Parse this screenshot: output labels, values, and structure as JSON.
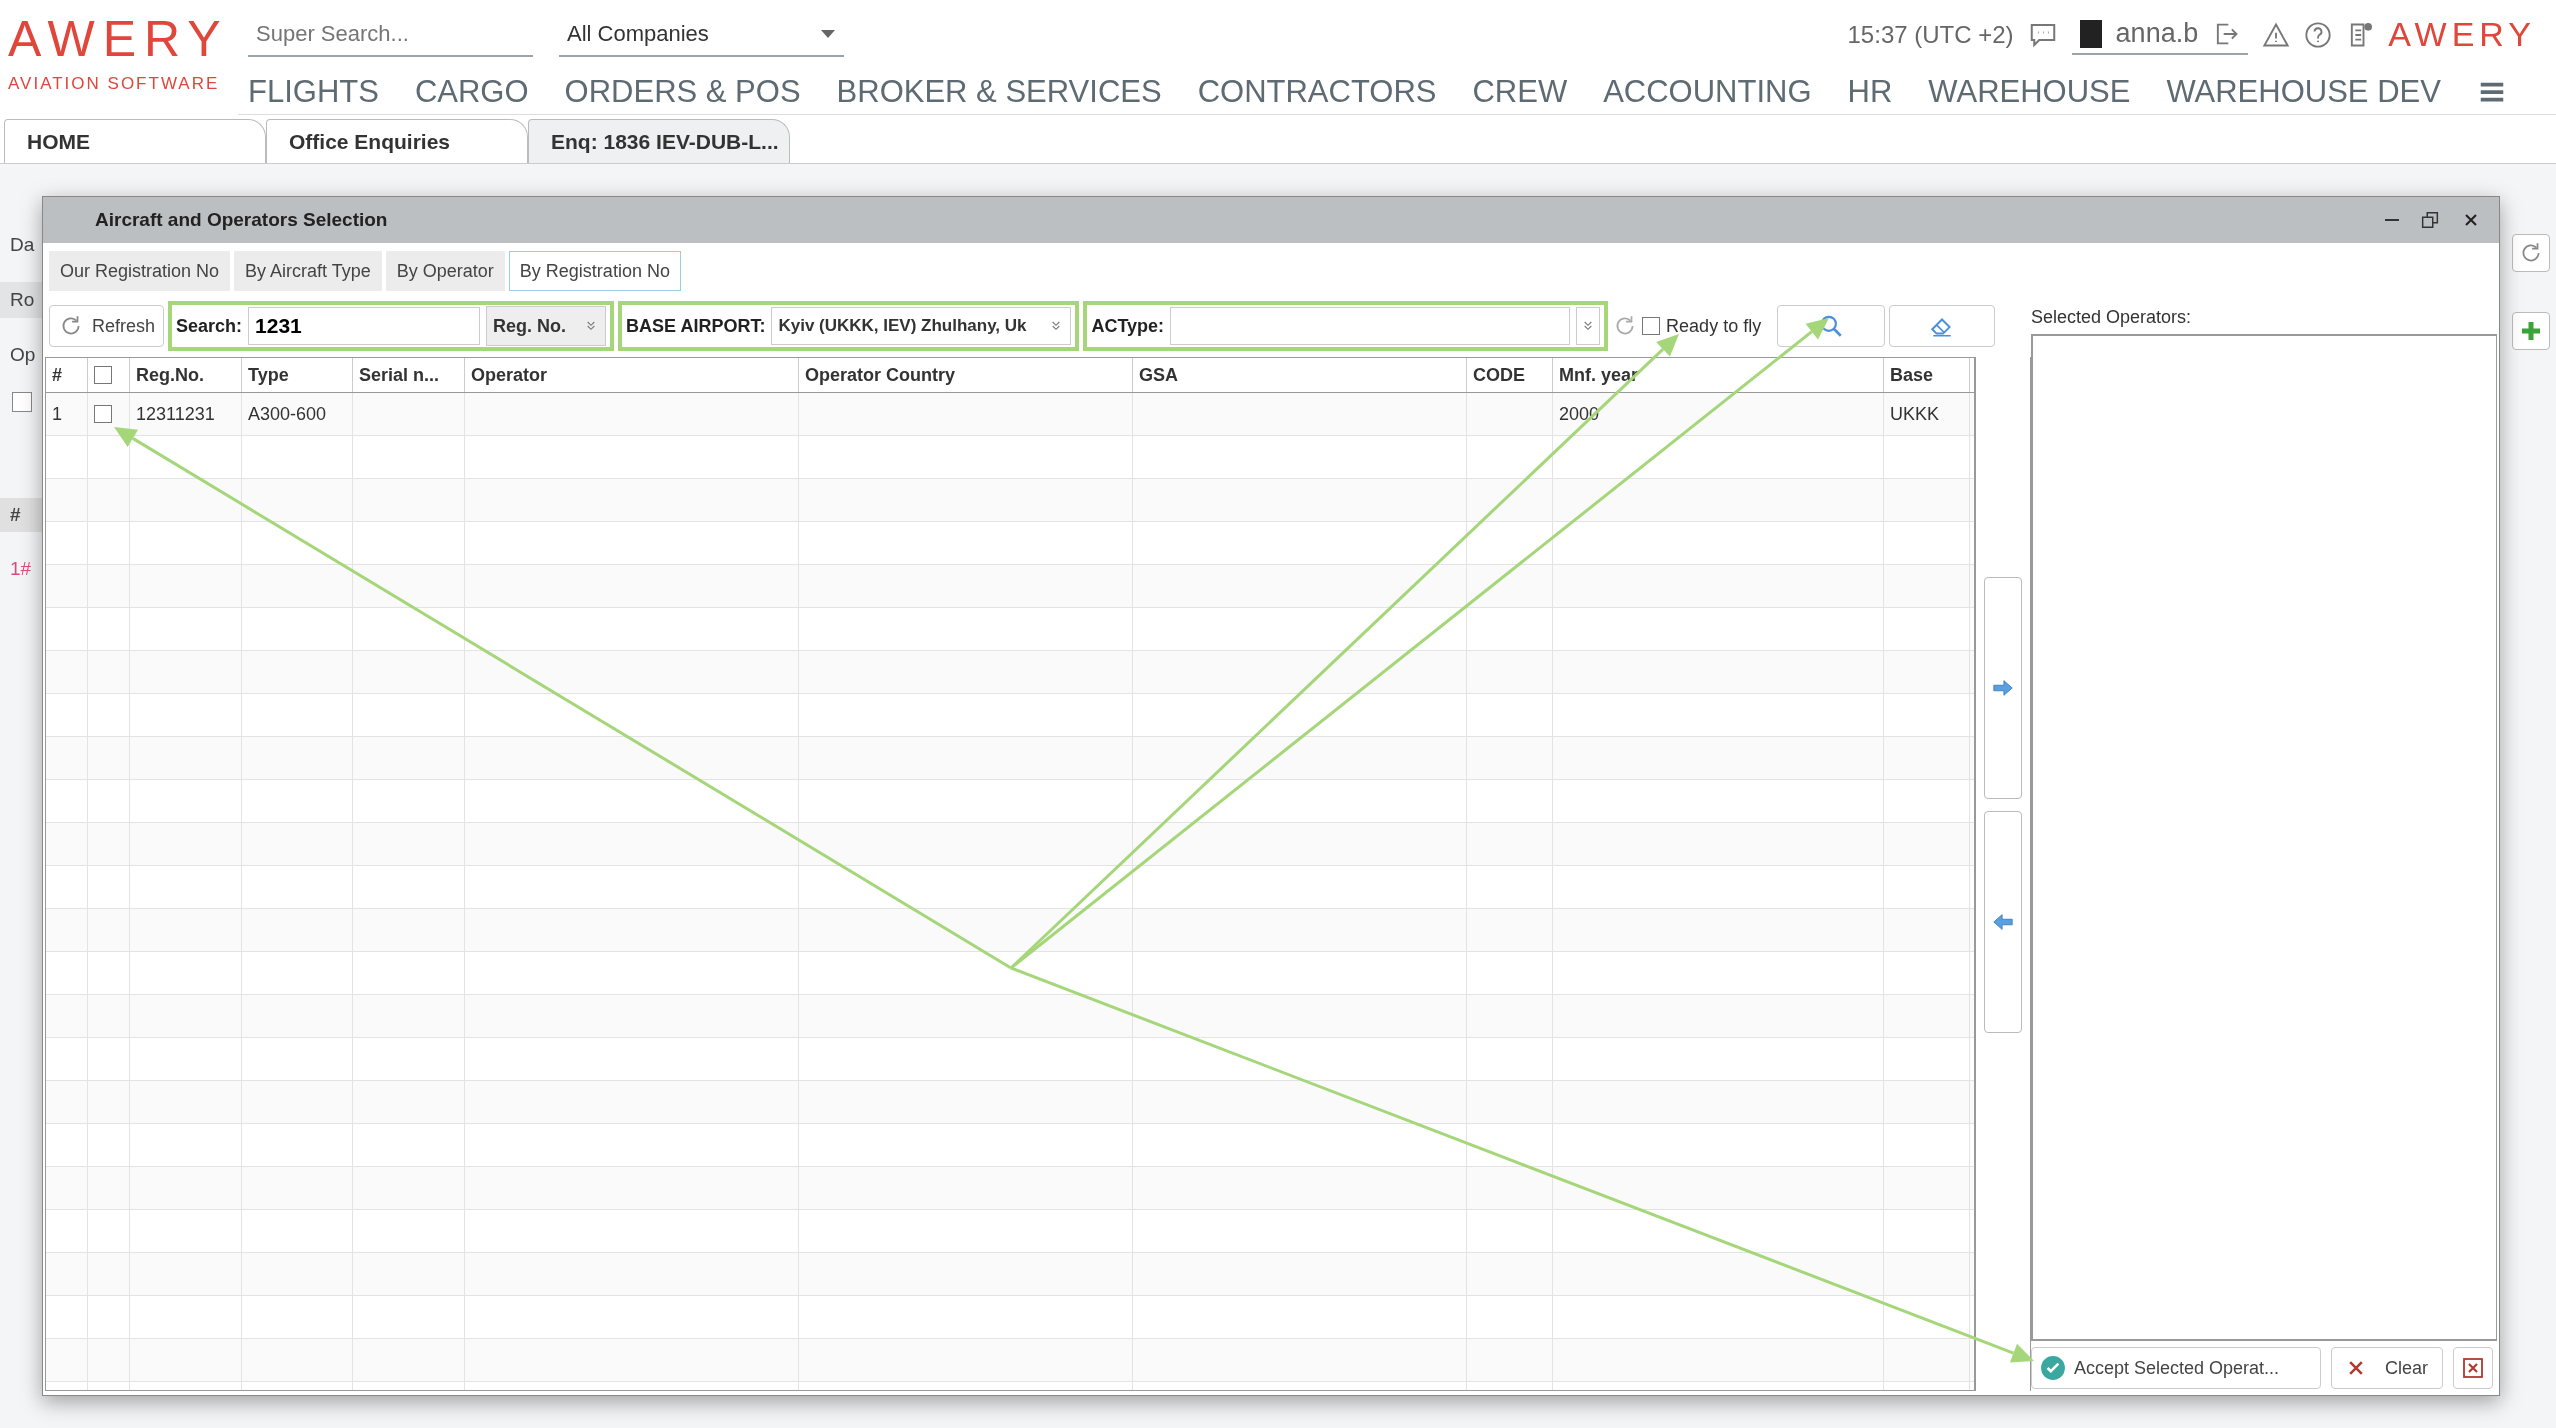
{
  "header": {
    "logo": "AWERY",
    "tagline": "AVIATION SOFTWARE",
    "search": {
      "placeholder": "Super Search..."
    },
    "company": "All Companies",
    "time": "15:37 (UTC +2)",
    "user": "anna.b",
    "logo_small": "AWERY"
  },
  "nav": [
    "FLIGHTS",
    "CARGO",
    "ORDERS & POS",
    "BROKER & SERVICES",
    "CONTRACTORS",
    "CREW",
    "ACCOUNTING",
    "HR",
    "WAREHOUSE",
    "WAREHOUSE DEV"
  ],
  "tabs": [
    {
      "label": "HOME",
      "selected": false
    },
    {
      "label": "Office Enquiries",
      "selected": false
    },
    {
      "label": "Enq: 1836 IEV-DUB-L...",
      "selected": true
    }
  ],
  "background": {
    "labels": [
      "Da",
      "Ro",
      "Op"
    ],
    "grid_header": "#",
    "grid_row": "1#",
    "checkbox": {
      "checked": false
    }
  },
  "dialog": {
    "title": "Aircraft and Operators Selection",
    "tabs": [
      {
        "label": "Our Registration No",
        "selected": false
      },
      {
        "label": "By Aircraft Type",
        "selected": false
      },
      {
        "label": "By Operator",
        "selected": false
      },
      {
        "label": "By Registration No",
        "selected": true
      }
    ],
    "toolbar": {
      "refresh": "Refresh",
      "search_label": "Search:",
      "search_value": "1231",
      "search_by": "Reg. No.",
      "airport_label": "BASE AIRPORT:",
      "airport_value": "Kyiv (UKKK, IEV) Zhulhany, Uk",
      "actype_label": "ACType:",
      "ready_to_fly": {
        "label": "Ready to fly",
        "checked": false
      }
    },
    "table": {
      "columns": [
        {
          "kind": "text",
          "label": "#"
        },
        {
          "kind": "checkbox",
          "checked": false
        },
        {
          "kind": "text",
          "label": "Reg.No."
        },
        {
          "kind": "text",
          "label": "Type"
        },
        {
          "kind": "text",
          "label": "Serial n..."
        },
        {
          "kind": "text",
          "label": "Operator"
        },
        {
          "kind": "text",
          "label": "Operator Country"
        },
        {
          "kind": "text",
          "label": "GSA"
        },
        {
          "kind": "text",
          "label": "CODE"
        },
        {
          "kind": "text",
          "label": "Mnf. year"
        },
        {
          "kind": "text",
          "label": "Base"
        }
      ],
      "rows": [
        {
          "checked": false,
          "cells": [
            "1",
            "",
            "12311231",
            "A300-600",
            "",
            "",
            "",
            "",
            "",
            "2000",
            "UKKK"
          ]
        }
      ]
    },
    "selected_label": "Selected Operators:",
    "accept": "Accept Selected Operat...",
    "clear": "Clear"
  }
}
